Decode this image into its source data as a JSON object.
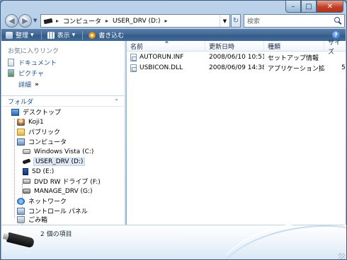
{
  "window": {
    "caption": {
      "minimize": "–",
      "maximize": "□",
      "close": "✕"
    }
  },
  "address_bar": {
    "back": "◀",
    "forward": "▶",
    "segments": [
      "コンピュータ",
      "USER_DRV (D:)"
    ],
    "separator": "▸",
    "refresh": "↻",
    "search_placeholder": "検索"
  },
  "toolbar": {
    "organize": "整理",
    "views": "表示",
    "burn": "書き込む",
    "help": "?"
  },
  "favorites": {
    "heading": "お気に入りリンク",
    "items": [
      "ドキュメント",
      "ピクチャ"
    ],
    "more": "詳細",
    "more_chevron": "»"
  },
  "folders": {
    "heading": "フォルダ",
    "chevron": "⌃",
    "tree": [
      {
        "label": "デスクトップ",
        "icon": "desktop-icon"
      },
      {
        "label": "Koji1",
        "icon": "user-folder-icon"
      },
      {
        "label": "パブリック",
        "icon": "public-folder-icon"
      },
      {
        "label": "コンピュータ",
        "icon": "computer-icon"
      },
      {
        "label": "Windows Vista (C:)",
        "icon": "hard-drive-icon"
      },
      {
        "label": "USER_DRV (D:)",
        "icon": "usb-drive-icon"
      },
      {
        "label": "SD (E:)",
        "icon": "sd-card-icon"
      },
      {
        "label": "DVD RW ドライブ (F:)",
        "icon": "dvd-drive-icon"
      },
      {
        "label": "MANAGE_DRV (G:)",
        "icon": "removable-drive-icon"
      },
      {
        "label": "ネットワーク",
        "icon": "network-icon"
      },
      {
        "label": "コントロール パネル",
        "icon": "control-panel-icon"
      },
      {
        "label": "ごみ箱",
        "icon": "recycle-bin-icon"
      }
    ]
  },
  "file_list": {
    "columns": {
      "name": "名前",
      "date": "更新日時",
      "type": "種類",
      "size": "サイズ"
    },
    "sort_indicator": "▲",
    "rows": [
      {
        "name": "AUTORUN.INF",
        "date": "2008/06/10 10:51",
        "type": "セットアップ情報",
        "size": ""
      },
      {
        "name": "USBICON.DLL",
        "date": "2008/06/09 14:38",
        "type": "アプリケーション拡張",
        "size": "5"
      }
    ]
  },
  "details_pane": {
    "count": "2 個の項目"
  }
}
